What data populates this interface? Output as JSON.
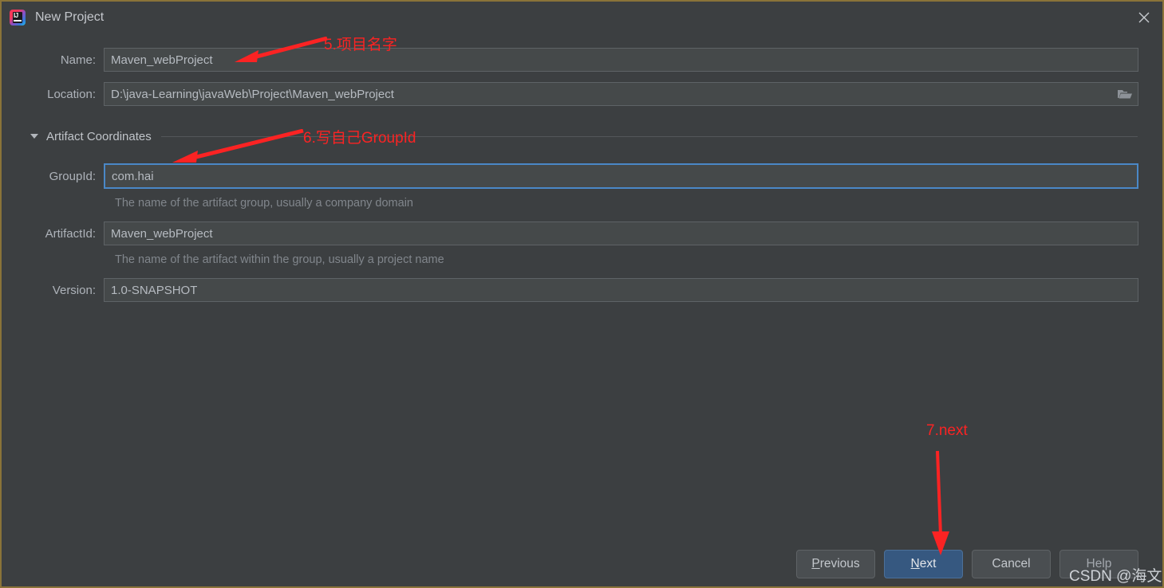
{
  "window": {
    "title": "New Project",
    "app_icon": "intellij-idea-icon",
    "close_icon": "close-icon",
    "border_color": "#8a7338",
    "background": "#3c3f41"
  },
  "form": {
    "name": {
      "label": "Name:",
      "value": "Maven_webProject"
    },
    "location": {
      "label": "Location:",
      "value": "D:\\java-Learning\\javaWeb\\Project\\Maven_webProject",
      "browse_icon": "folder-open-icon"
    },
    "section": {
      "label": "Artifact Coordinates",
      "expanded": true,
      "toggle_icon": "triangle-down-icon"
    },
    "group_id": {
      "label": "GroupId:",
      "value": "com.hai",
      "hint": "The name of the artifact group, usually a company domain",
      "focused": true,
      "focus_color": "#4a88c7"
    },
    "artifact_id": {
      "label": "ArtifactId:",
      "value": "Maven_webProject",
      "hint": "The name of the artifact within the group, usually a project name"
    },
    "version": {
      "label": "Version:",
      "value": "1.0-SNAPSHOT"
    }
  },
  "buttons": {
    "previous": {
      "label": "Previous",
      "mnemonic": "P",
      "rest": "revious"
    },
    "next": {
      "label": "Next",
      "mnemonic": "N",
      "rest": "ext",
      "primary": true
    },
    "cancel": {
      "label": "Cancel"
    },
    "help": {
      "label": "Help",
      "disabled": true
    }
  },
  "annotations": [
    {
      "id": "anno-name",
      "text": "5.项目名字",
      "color": "#fb2323"
    },
    {
      "id": "anno-groupid",
      "text": "6.写自己GroupId",
      "color": "#fb2323"
    },
    {
      "id": "anno-next",
      "text": "7.next",
      "color": "#fb2323"
    }
  ],
  "watermark": {
    "text": "CSDN @海文宇"
  }
}
